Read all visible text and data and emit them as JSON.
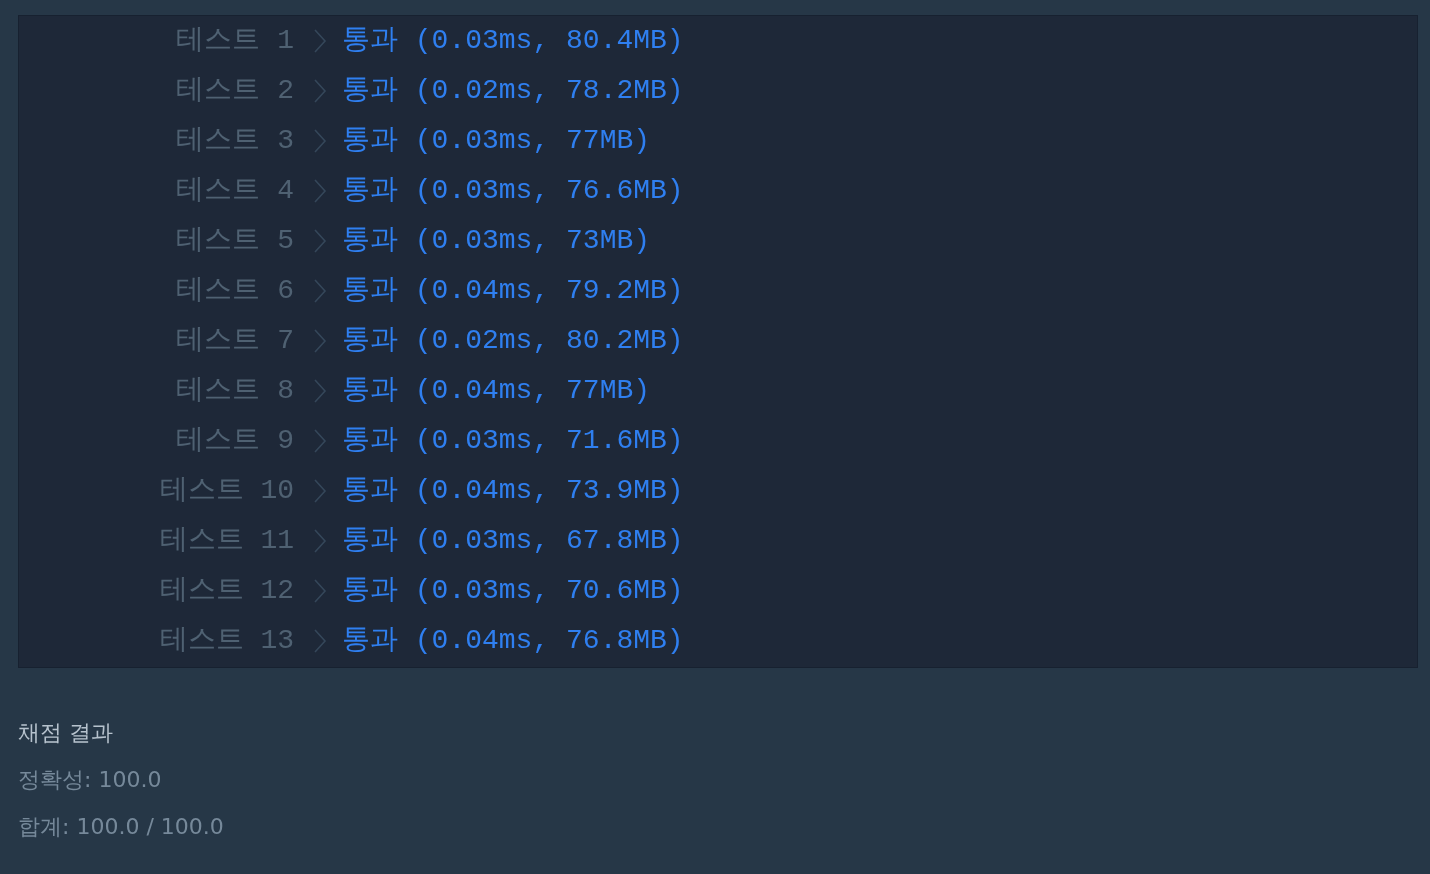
{
  "tests": [
    {
      "label": "테스트 1",
      "result": "통과 (0.03ms, 80.4MB)"
    },
    {
      "label": "테스트 2",
      "result": "통과 (0.02ms, 78.2MB)"
    },
    {
      "label": "테스트 3",
      "result": "통과 (0.03ms, 77MB)"
    },
    {
      "label": "테스트 4",
      "result": "통과 (0.03ms, 76.6MB)"
    },
    {
      "label": "테스트 5",
      "result": "통과 (0.03ms, 73MB)"
    },
    {
      "label": "테스트 6",
      "result": "통과 (0.04ms, 79.2MB)"
    },
    {
      "label": "테스트 7",
      "result": "통과 (0.02ms, 80.2MB)"
    },
    {
      "label": "테스트 8",
      "result": "통과 (0.04ms, 77MB)"
    },
    {
      "label": "테스트 9",
      "result": "통과 (0.03ms, 71.6MB)"
    },
    {
      "label": "테스트 10",
      "result": "통과 (0.04ms, 73.9MB)"
    },
    {
      "label": "테스트 11",
      "result": "통과 (0.03ms, 67.8MB)"
    },
    {
      "label": "테스트 12",
      "result": "통과 (0.03ms, 70.6MB)"
    },
    {
      "label": "테스트 13",
      "result": "통과 (0.04ms, 76.8MB)"
    }
  ],
  "summary": {
    "title": "채점 결과",
    "lines": [
      "정확성: 100.0",
      "합계: 100.0 / 100.0"
    ]
  }
}
